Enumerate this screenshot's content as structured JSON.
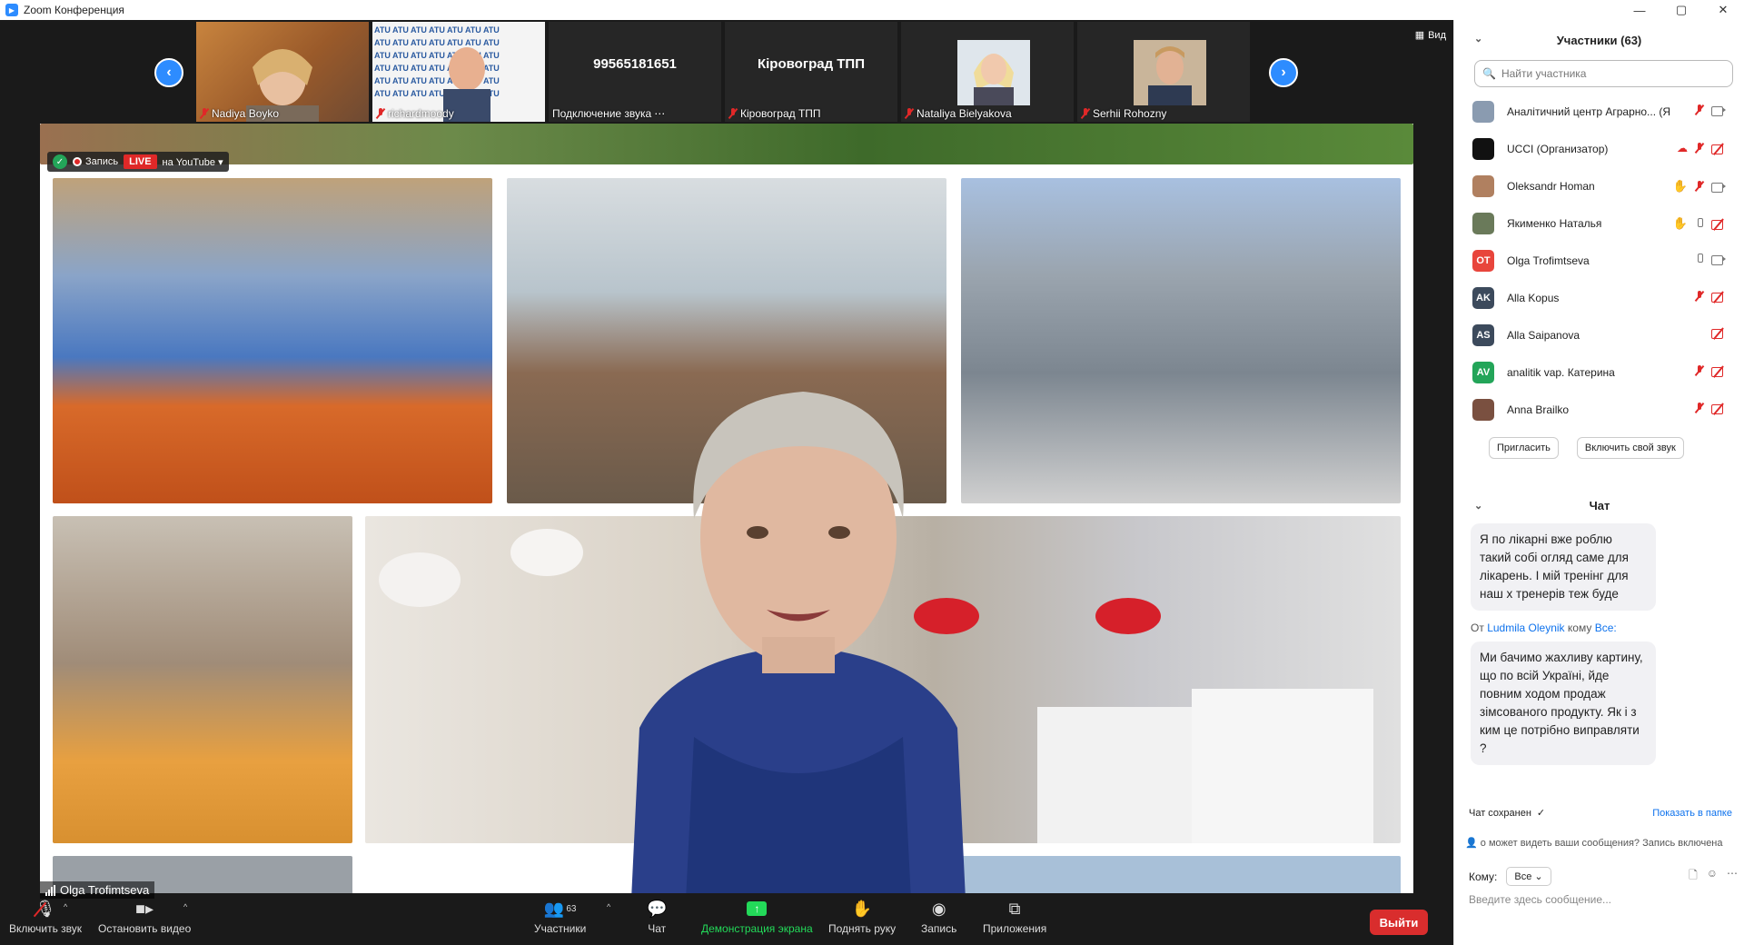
{
  "window": {
    "title": "Zoom Конференция",
    "controls": [
      "—",
      "▢",
      "✕"
    ]
  },
  "filmstrip": {
    "prev_icon": "chevron-left-icon",
    "next_icon": "chevron-right-icon",
    "view_label": "Вид",
    "tiles": [
      {
        "name": "Nadiya Boyko",
        "muted": true,
        "type": "video"
      },
      {
        "name": "richardmoody",
        "muted": true,
        "type": "video"
      },
      {
        "name": "Подключение звука",
        "big": "99565181651",
        "type": "phone"
      },
      {
        "name": "Кіровоград ТПП",
        "big": "Кіровоград ТПП",
        "muted": true,
        "type": "text"
      },
      {
        "name": "Nataliya Bielyakova",
        "muted": true,
        "type": "video"
      },
      {
        "name": "Serhii Rohozny",
        "muted": true,
        "type": "video"
      }
    ]
  },
  "recording": {
    "label": "Запись",
    "live": "LIVE",
    "platform": "на YouTube"
  },
  "speaker": {
    "name": "Olga Trofimtseva"
  },
  "toolbar": {
    "audio": "Включить звук",
    "video": "Остановить видео",
    "participants": "Участники",
    "participants_count": "63",
    "chat": "Чат",
    "share": "Демонстрация экрана",
    "raise_hand": "Поднять руку",
    "record": "Запись",
    "apps": "Приложения",
    "leave": "Выйти"
  },
  "participants_panel": {
    "title": "Участники (63)",
    "search_placeholder": "Найти участника",
    "list": [
      {
        "name": "Аналітичний центр Аграрно... (Я)",
        "avatar_color": "#8a9bb0",
        "initials": "",
        "hand": false,
        "mic": "off",
        "cam": "on"
      },
      {
        "name": "UCCI (Организатор)",
        "avatar_color": "#111111",
        "initials": "",
        "hand": false,
        "mic": "off",
        "cam": "off",
        "cloud": true
      },
      {
        "name": "Oleksandr Homan",
        "avatar_color": "#b08060",
        "initials": "",
        "hand": true,
        "mic": "off",
        "cam": "on"
      },
      {
        "name": "Якименко Наталья",
        "avatar_color": "#6a7a5a",
        "initials": "",
        "hand": "grey",
        "mic": "on",
        "cam": "off"
      },
      {
        "name": "Olga Trofimtseva",
        "avatar_color": "#e8453c",
        "initials": "OT",
        "hand": false,
        "mic": "on",
        "cam": "on"
      },
      {
        "name": "Alla Kopus",
        "avatar_color": "#3c4a5c",
        "initials": "AK",
        "hand": false,
        "mic": "off",
        "cam": "off"
      },
      {
        "name": "Alla Saipanova",
        "avatar_color": "#3c4a5c",
        "initials": "AS",
        "hand": false,
        "mic": "none",
        "cam": "off"
      },
      {
        "name": "analitik vap. Катерина",
        "avatar_color": "#23a559",
        "initials": "AV",
        "hand": false,
        "mic": "off",
        "cam": "off"
      },
      {
        "name": "Anna Brailko",
        "avatar_color": "#7a5040",
        "initials": "",
        "hand": false,
        "mic": "off",
        "cam": "off"
      }
    ],
    "invite": "Пригласить",
    "unmute_me": "Включить свой звук"
  },
  "chat": {
    "title": "Чат",
    "message1": "Я по лікарні вже роблю такий собі огляд саме для лікарень. І мій тренінг для наш х тренерів теж буде",
    "from_prefix": "От",
    "from_name": "Ludmila Oleynik",
    "to_prefix": "кому",
    "to_name": "Все:",
    "message2": "Ми бачимо жахливу картину, що по всій Україні, йде повним ходом продаж зімсованого продукту. Як і з ким це потрібно виправляти ?",
    "saved": "Чат сохранен",
    "show_folder": "Показать в папке",
    "info": "о может видеть ваши сообщения? Запись включена",
    "to_label": "Кому:",
    "to_value": "Все",
    "input_placeholder": "Введите здесь сообщение..."
  },
  "colors": {
    "zoom_blue": "#2d8cff",
    "leave_red": "#d92d2d",
    "share_green": "#23d959"
  }
}
